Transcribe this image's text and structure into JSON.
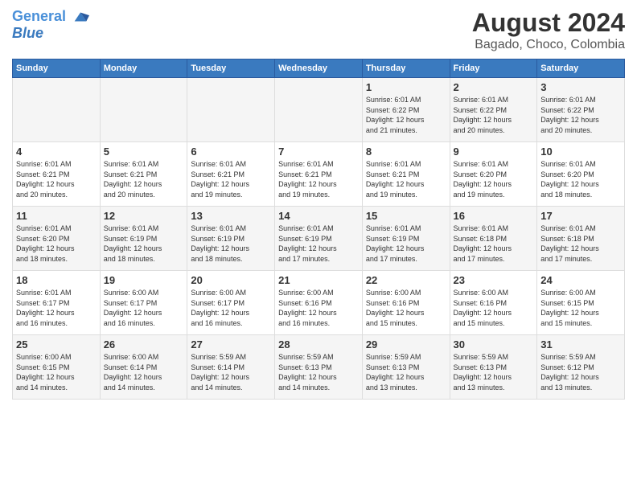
{
  "header": {
    "logo_line1": "General",
    "logo_line2": "Blue",
    "main_title": "August 2024",
    "subtitle": "Bagado, Choco, Colombia"
  },
  "weekdays": [
    "Sunday",
    "Monday",
    "Tuesday",
    "Wednesday",
    "Thursday",
    "Friday",
    "Saturday"
  ],
  "weeks": [
    [
      {
        "day": "",
        "info": ""
      },
      {
        "day": "",
        "info": ""
      },
      {
        "day": "",
        "info": ""
      },
      {
        "day": "",
        "info": ""
      },
      {
        "day": "1",
        "info": "Sunrise: 6:01 AM\nSunset: 6:22 PM\nDaylight: 12 hours\nand 21 minutes."
      },
      {
        "day": "2",
        "info": "Sunrise: 6:01 AM\nSunset: 6:22 PM\nDaylight: 12 hours\nand 20 minutes."
      },
      {
        "day": "3",
        "info": "Sunrise: 6:01 AM\nSunset: 6:22 PM\nDaylight: 12 hours\nand 20 minutes."
      }
    ],
    [
      {
        "day": "4",
        "info": "Sunrise: 6:01 AM\nSunset: 6:21 PM\nDaylight: 12 hours\nand 20 minutes."
      },
      {
        "day": "5",
        "info": "Sunrise: 6:01 AM\nSunset: 6:21 PM\nDaylight: 12 hours\nand 20 minutes."
      },
      {
        "day": "6",
        "info": "Sunrise: 6:01 AM\nSunset: 6:21 PM\nDaylight: 12 hours\nand 19 minutes."
      },
      {
        "day": "7",
        "info": "Sunrise: 6:01 AM\nSunset: 6:21 PM\nDaylight: 12 hours\nand 19 minutes."
      },
      {
        "day": "8",
        "info": "Sunrise: 6:01 AM\nSunset: 6:21 PM\nDaylight: 12 hours\nand 19 minutes."
      },
      {
        "day": "9",
        "info": "Sunrise: 6:01 AM\nSunset: 6:20 PM\nDaylight: 12 hours\nand 19 minutes."
      },
      {
        "day": "10",
        "info": "Sunrise: 6:01 AM\nSunset: 6:20 PM\nDaylight: 12 hours\nand 18 minutes."
      }
    ],
    [
      {
        "day": "11",
        "info": "Sunrise: 6:01 AM\nSunset: 6:20 PM\nDaylight: 12 hours\nand 18 minutes."
      },
      {
        "day": "12",
        "info": "Sunrise: 6:01 AM\nSunset: 6:19 PM\nDaylight: 12 hours\nand 18 minutes."
      },
      {
        "day": "13",
        "info": "Sunrise: 6:01 AM\nSunset: 6:19 PM\nDaylight: 12 hours\nand 18 minutes."
      },
      {
        "day": "14",
        "info": "Sunrise: 6:01 AM\nSunset: 6:19 PM\nDaylight: 12 hours\nand 17 minutes."
      },
      {
        "day": "15",
        "info": "Sunrise: 6:01 AM\nSunset: 6:19 PM\nDaylight: 12 hours\nand 17 minutes."
      },
      {
        "day": "16",
        "info": "Sunrise: 6:01 AM\nSunset: 6:18 PM\nDaylight: 12 hours\nand 17 minutes."
      },
      {
        "day": "17",
        "info": "Sunrise: 6:01 AM\nSunset: 6:18 PM\nDaylight: 12 hours\nand 17 minutes."
      }
    ],
    [
      {
        "day": "18",
        "info": "Sunrise: 6:01 AM\nSunset: 6:17 PM\nDaylight: 12 hours\nand 16 minutes."
      },
      {
        "day": "19",
        "info": "Sunrise: 6:00 AM\nSunset: 6:17 PM\nDaylight: 12 hours\nand 16 minutes."
      },
      {
        "day": "20",
        "info": "Sunrise: 6:00 AM\nSunset: 6:17 PM\nDaylight: 12 hours\nand 16 minutes."
      },
      {
        "day": "21",
        "info": "Sunrise: 6:00 AM\nSunset: 6:16 PM\nDaylight: 12 hours\nand 16 minutes."
      },
      {
        "day": "22",
        "info": "Sunrise: 6:00 AM\nSunset: 6:16 PM\nDaylight: 12 hours\nand 15 minutes."
      },
      {
        "day": "23",
        "info": "Sunrise: 6:00 AM\nSunset: 6:16 PM\nDaylight: 12 hours\nand 15 minutes."
      },
      {
        "day": "24",
        "info": "Sunrise: 6:00 AM\nSunset: 6:15 PM\nDaylight: 12 hours\nand 15 minutes."
      }
    ],
    [
      {
        "day": "25",
        "info": "Sunrise: 6:00 AM\nSunset: 6:15 PM\nDaylight: 12 hours\nand 14 minutes."
      },
      {
        "day": "26",
        "info": "Sunrise: 6:00 AM\nSunset: 6:14 PM\nDaylight: 12 hours\nand 14 minutes."
      },
      {
        "day": "27",
        "info": "Sunrise: 5:59 AM\nSunset: 6:14 PM\nDaylight: 12 hours\nand 14 minutes."
      },
      {
        "day": "28",
        "info": "Sunrise: 5:59 AM\nSunset: 6:13 PM\nDaylight: 12 hours\nand 14 minutes."
      },
      {
        "day": "29",
        "info": "Sunrise: 5:59 AM\nSunset: 6:13 PM\nDaylight: 12 hours\nand 13 minutes."
      },
      {
        "day": "30",
        "info": "Sunrise: 5:59 AM\nSunset: 6:13 PM\nDaylight: 12 hours\nand 13 minutes."
      },
      {
        "day": "31",
        "info": "Sunrise: 5:59 AM\nSunset: 6:12 PM\nDaylight: 12 hours\nand 13 minutes."
      }
    ]
  ]
}
